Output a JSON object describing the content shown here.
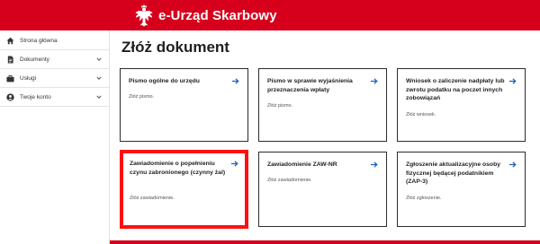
{
  "header": {
    "brand": "e-Urząd Skarbowy",
    "brand_color": "#d6001c"
  },
  "sidebar": {
    "items": [
      {
        "label": "Strona główna",
        "icon": "home-icon",
        "has_chevron": false
      },
      {
        "label": "Dokumenty",
        "icon": "document-icon",
        "has_chevron": true
      },
      {
        "label": "Usługi",
        "icon": "briefcase-icon",
        "has_chevron": true
      },
      {
        "label": "Twoje konto",
        "icon": "account-icon",
        "has_chevron": true
      }
    ]
  },
  "main": {
    "title": "Złóż dokument",
    "cards": [
      {
        "title": "Pismo ogólne do urzędu",
        "desc": "Złóż pismo."
      },
      {
        "title": "Pismo w sprawie wyjaśnienia przeznaczenia wpłaty",
        "desc": "Złóż pismo."
      },
      {
        "title": "Wniosek o zaliczenie nadpłaty lub zwrotu podatku na poczet innych zobowiązań",
        "desc": "Złóż wniosek."
      },
      {
        "title": "Zawiadomienie o popełnieniu czynu zabronionego (czynny żal)",
        "desc": "Złóż zawiadomienie.",
        "highlighted": true
      },
      {
        "title": "Zawiadomienie ZAW-NR",
        "desc": "Złóż zawiadomienie."
      },
      {
        "title": "Zgłoszenie aktualizacyjne osoby fizycznej będącej podatnikiem (ZAP-3)",
        "desc": "Złóż zgłoszenie."
      }
    ],
    "arrow_icon": "arrow-right-icon",
    "accent_color": "#1f5fbf",
    "highlight_color": "#ff1010"
  }
}
